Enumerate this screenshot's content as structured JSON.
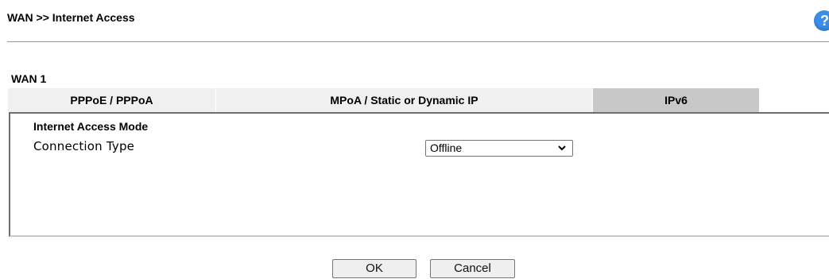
{
  "header": {
    "title": "WAN >> Internet Access",
    "help_icon": "question-mark-icon",
    "help_text": "?"
  },
  "wan": {
    "label": "WAN 1"
  },
  "tabs": [
    {
      "label": "PPPoE / PPPoA",
      "active": false
    },
    {
      "label": "MPoA / Static or Dynamic IP",
      "active": false
    },
    {
      "label": "IPv6",
      "active": true
    }
  ],
  "panel": {
    "heading": "Internet Access Mode",
    "connection_type_label": "Connection Type",
    "connection_type_value": "Offline"
  },
  "buttons": {
    "ok": "OK",
    "cancel": "Cancel"
  },
  "colors": {
    "active_tab": "#c8c8c8",
    "inactive_tab": "#f0f0f0",
    "help_icon": "#3a8ee6"
  }
}
